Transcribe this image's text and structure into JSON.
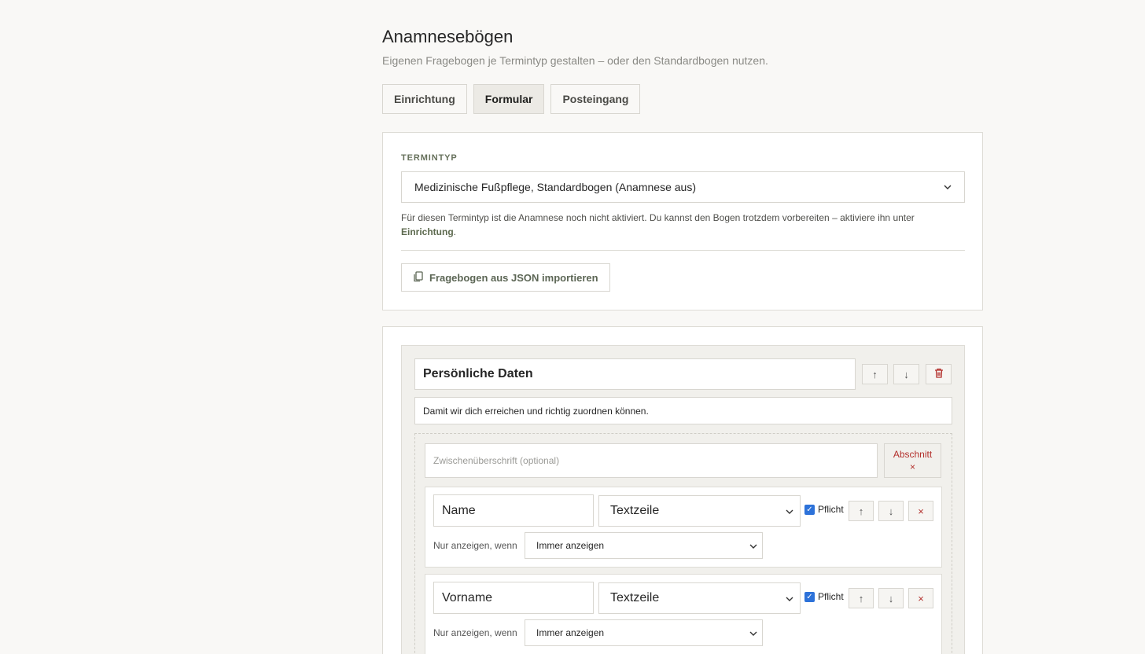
{
  "header": {
    "title": "Anamnesebögen",
    "subtitle": "Eigenen Fragebogen je Termintyp gestalten – oder den Standardbogen nutzen."
  },
  "tabs": [
    {
      "label": "Einrichtung",
      "active": false
    },
    {
      "label": "Formular",
      "active": true
    },
    {
      "label": "Posteingang",
      "active": false
    }
  ],
  "termintyp": {
    "label": "TERMINTYP",
    "selected": "Medizinische Fußpflege, Standardbogen (Anamnese aus)",
    "hint": "Für diesen Termintyp ist die Anamnese noch nicht aktiviert. Du kannst den Bogen trotzdem vorbereiten – aktiviere ihn unter",
    "hint_link": "Einrichtung",
    "hint_end": ".",
    "import_label": "Fragebogen aus JSON importieren"
  },
  "section": {
    "title": "Persönliche Daten",
    "description": "Damit wir dich erreichen und richtig zuordnen können.",
    "subheading_placeholder": "Zwischenüberschrift (optional)",
    "remove_label": "Abschnitt",
    "remove_icon": "×"
  },
  "fields": [
    {
      "name": "Name",
      "type": "Textzeile",
      "required_label": "Pflicht",
      "required": true,
      "condition_label": "Nur anzeigen, wenn",
      "condition": "Immer anzeigen"
    },
    {
      "name": "Vorname",
      "type": "Textzeile",
      "required_label": "Pflicht",
      "required": true,
      "condition_label": "Nur anzeigen, wenn",
      "condition": "Immer anzeigen"
    }
  ],
  "icons": {
    "up": "↑",
    "down": "↓",
    "delete": "×",
    "chevron": "⌄",
    "trash": "trash-icon",
    "copy": "copy-icon"
  },
  "colors": {
    "accent": "#5d6a4f",
    "danger": "#b3302c",
    "checkbox": "#2d72d9"
  }
}
